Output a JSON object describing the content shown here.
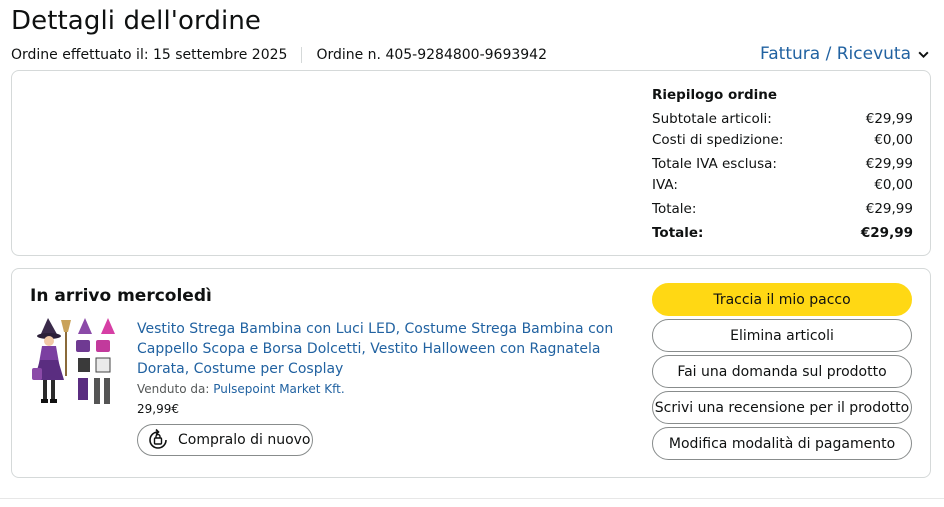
{
  "page": {
    "title": "Dettagli dell'ordine",
    "order_date": "Ordine effettuato il: 15 settembre 2025",
    "order_number": "Ordine n. 405-9284800-9693942",
    "invoice_link": "Fattura / Ricevuta"
  },
  "summary": {
    "heading": "Riepilogo ordine",
    "rows": [
      {
        "label": "Subtotale articoli:",
        "value": "€29,99"
      },
      {
        "label": "Costi di spedizione:",
        "value": "€0,00"
      },
      {
        "label": "Totale IVA esclusa:",
        "value": "€29,99"
      },
      {
        "label": "IVA:",
        "value": "€0,00"
      },
      {
        "label": "Totale:",
        "value": "€29,99"
      },
      {
        "label": "Totale:",
        "value": "€29,99"
      }
    ]
  },
  "shipment": {
    "status": "In arrivo mercoledì",
    "product_title": "Vestito Strega Bambina con Luci LED, Costume Strega Bambina con Cappello Scopa e Borsa Dolcetti, Vestito Halloween con Ragnatela Dorata, Costume per Cosplay",
    "seller_label": "Venduto da: ",
    "seller_name": "Pulsepoint Market Kft.",
    "price": "29,99€",
    "buy_again": "Compralo di nuovo"
  },
  "actions": {
    "track": "Traccia il mio pacco",
    "delete": "Elimina articoli",
    "question": "Fai una domanda sul prodotto",
    "review": "Scrivi una recensione per il prodotto",
    "payment": "Modifica modalità di pagamento"
  },
  "colors": {
    "link": "#2162a1",
    "primary_button": "#ffd814",
    "border": "#d5d9d9"
  }
}
